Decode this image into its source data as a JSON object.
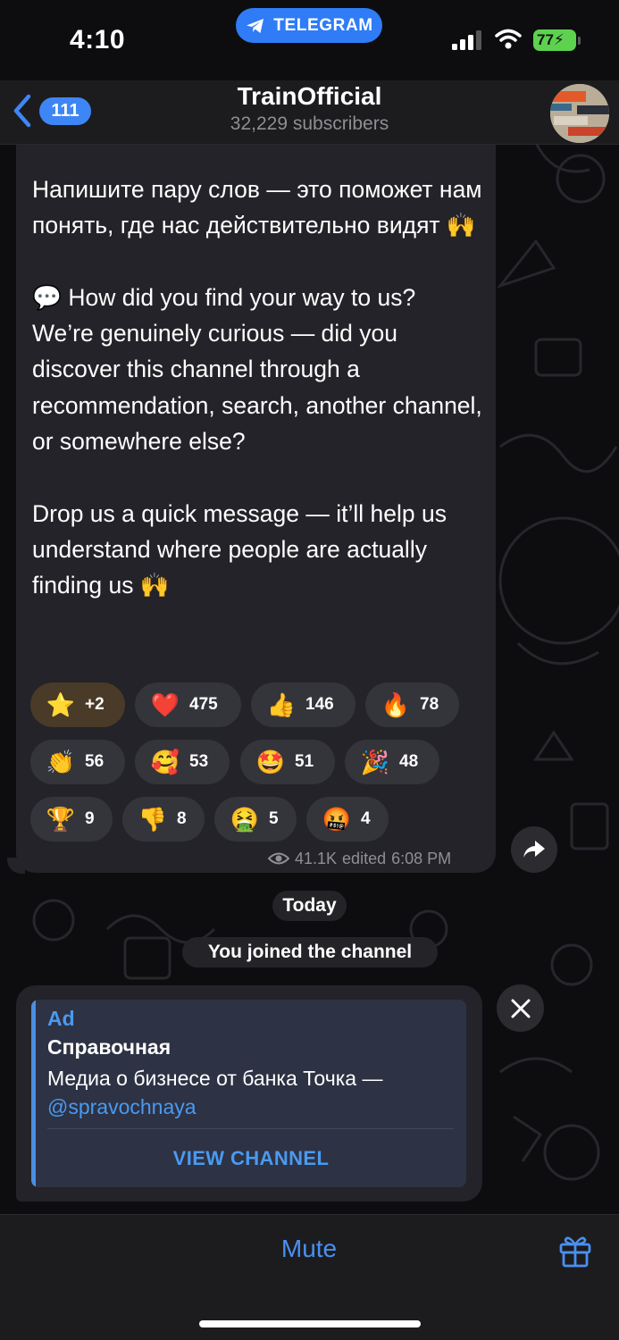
{
  "status_bar": {
    "time": "4:10",
    "app_pill": "TELEGRAM",
    "battery": "77"
  },
  "header": {
    "back_count": "111",
    "title": "TrainOfficial",
    "subtitle": "32,229 subscribers"
  },
  "message": {
    "text": "Напишите пару слов — это поможет нам понять, где нас действительно видят 🙌\n\n💬 How did you find your way to us?\nWe’re genuinely curious — did you discover this channel through a recommendation, search, another channel, or somewhere else?\n\nDrop us a quick message — it’ll help us understand where people are actually finding us 🙌",
    "reactions": [
      {
        "emoji": "⭐",
        "count": "+2"
      },
      {
        "emoji": "❤️",
        "count": "475"
      },
      {
        "emoji": "👍",
        "count": "146"
      },
      {
        "emoji": "🔥",
        "count": "78"
      },
      {
        "emoji": "👏",
        "count": "56"
      },
      {
        "emoji": "🥰",
        "count": "53"
      },
      {
        "emoji": "🤩",
        "count": "51"
      },
      {
        "emoji": "🎉",
        "count": "48"
      },
      {
        "emoji": "🏆",
        "count": "9"
      },
      {
        "emoji": "👎",
        "count": "8"
      },
      {
        "emoji": "🤮",
        "count": "5"
      },
      {
        "emoji": "🤬",
        "count": "4"
      }
    ],
    "views": "41.1K",
    "edited_label": "edited",
    "time": "6:08 PM"
  },
  "date_chip": "Today",
  "service_message": "You joined the channel",
  "ad": {
    "label": "Ad",
    "title": "Справочная",
    "description": "Медиа о бизнесе от банка Точка — ",
    "link": "@spravochnaya",
    "button": "VIEW CHANNEL"
  },
  "bottom_bar": {
    "mute_label": "Mute"
  },
  "colors": {
    "accent": "#3e86f5",
    "link": "#4a9af0",
    "bubble": "#232329",
    "battery": "#5dd24f"
  },
  "icons": [
    "telegram-plane-icon",
    "signal-icon",
    "wifi-icon",
    "battery-icon",
    "chevron-left-icon",
    "eye-icon",
    "share-arrow-icon",
    "close-icon",
    "gift-icon"
  ]
}
